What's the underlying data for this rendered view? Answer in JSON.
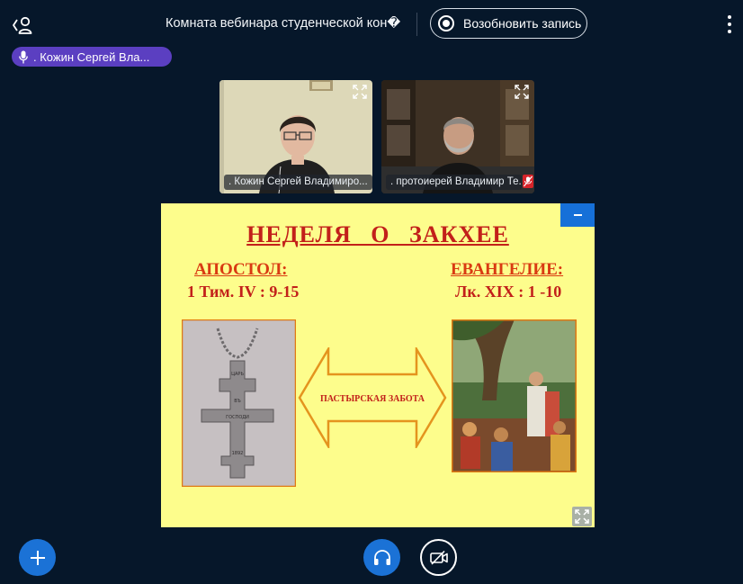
{
  "header": {
    "room_title": "Комната вебинара студенческой кон�",
    "record_label": "Возобновить запись"
  },
  "talking_indicator": {
    "name": ". Кожин Сергей Вла..."
  },
  "video_tiles": [
    {
      "label": ". Кожин Сергей Владимиро..."
    },
    {
      "label": ". протоиерей Владимир Те..."
    }
  ],
  "presentation": {
    "title": "НЕДЕЛЯ   О   ЗАКХЕЕ",
    "left_heading": "АПОСТОЛ:",
    "left_reference": "1 Тим. IV : 9-15",
    "right_heading": "ЕВАНГЕЛИЕ:",
    "right_reference": "Лк.  XIX : 1 -10",
    "arrow_text": "ПАСТЫРСКАЯ ЗАБОТА",
    "cross_inscription": [
      "ЦАРЬ",
      "ВЪ",
      "ГОСПОДИ",
      "1892"
    ]
  },
  "colors": {
    "background": "#06172a",
    "accent_blue": "#1b72d6",
    "talking_pill": "#5b3fc1",
    "slide_background": "#fdfd8c",
    "slide_title": "#c2201a"
  }
}
